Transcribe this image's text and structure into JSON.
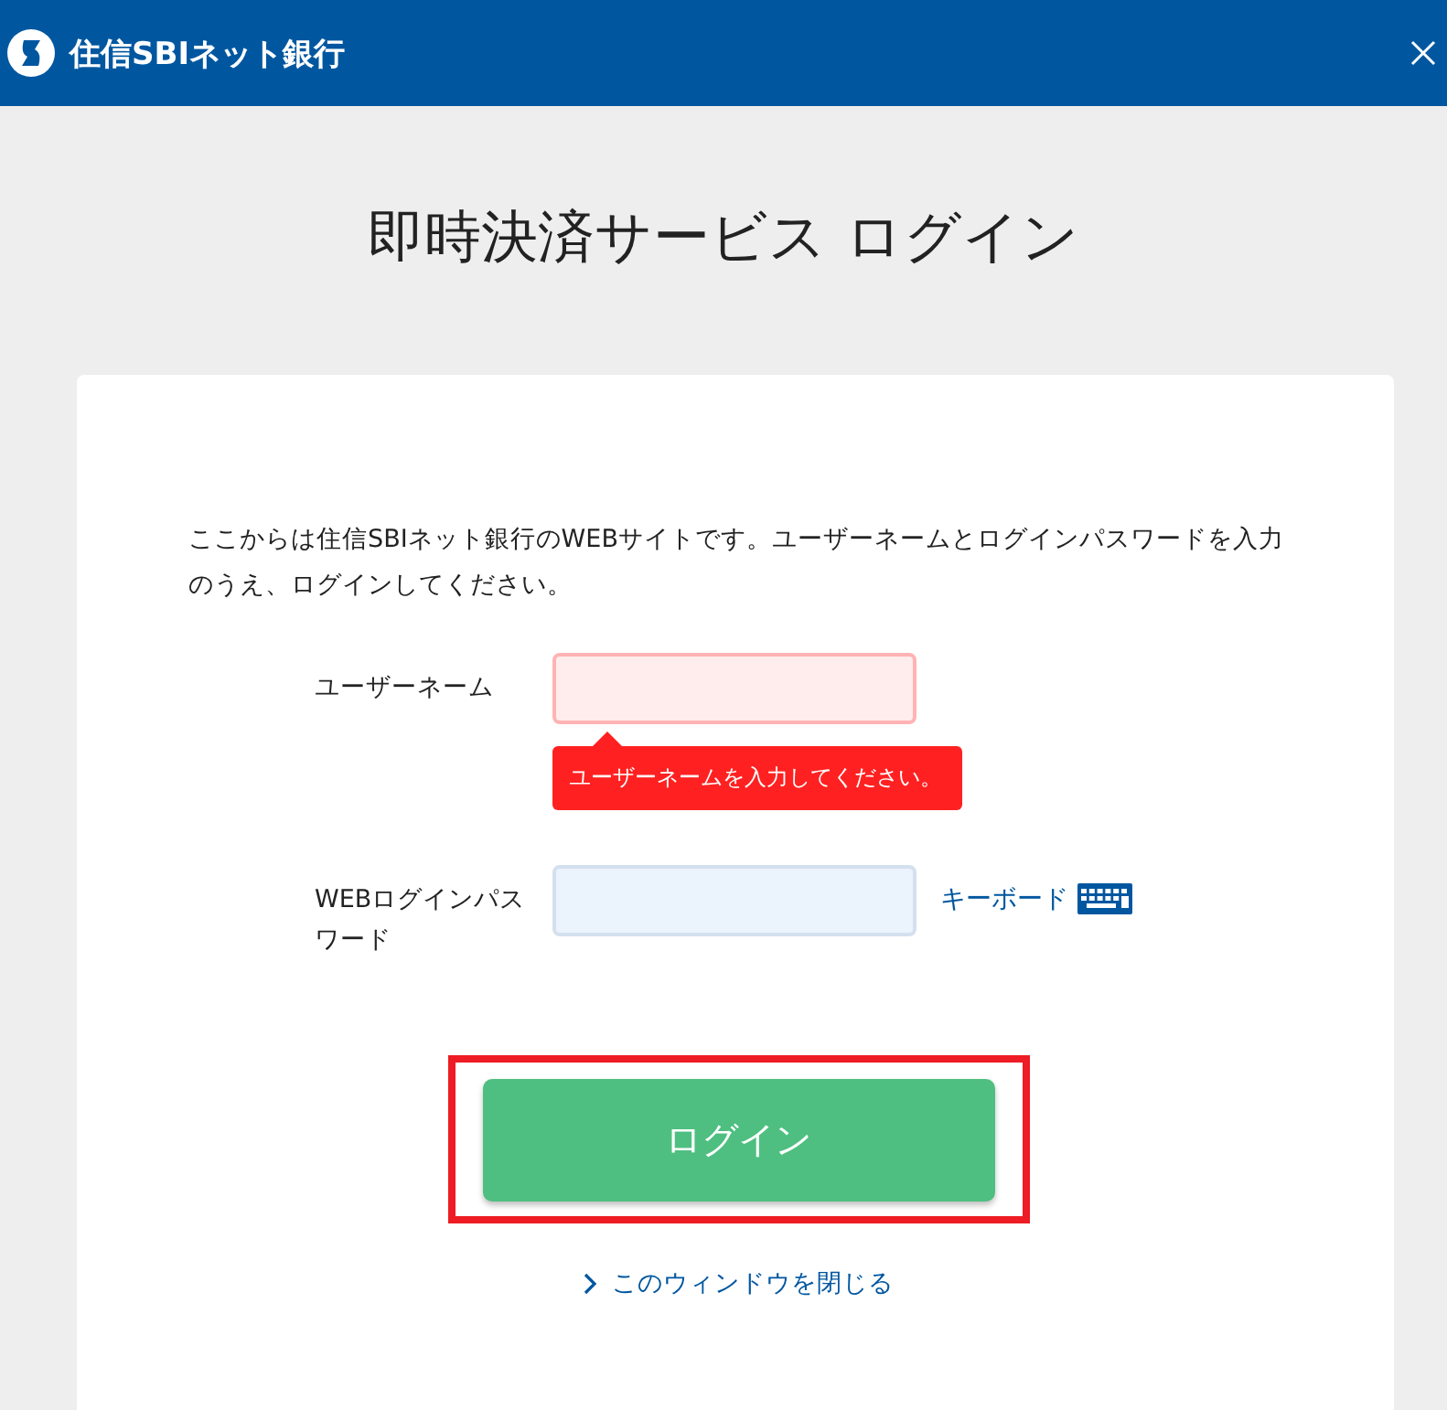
{
  "header": {
    "brand": "住信SBIネット銀行"
  },
  "title": "即時決済サービス ログイン",
  "intro": "ここからは住信SBIネット銀行のWEBサイトです。ユーザーネームとログインパスワードを入力のうえ、ログインしてください。",
  "fields": [
    {
      "label": "ユーザーネーム",
      "error": "ユーザーネームを入力してください。"
    },
    {
      "label": "WEBログインパスワード",
      "keyboard_link": "キーボード"
    }
  ],
  "login_button": {
    "label": "ログイン",
    "highlighted": true
  },
  "close_link": "このウィンドウを閉じる"
}
